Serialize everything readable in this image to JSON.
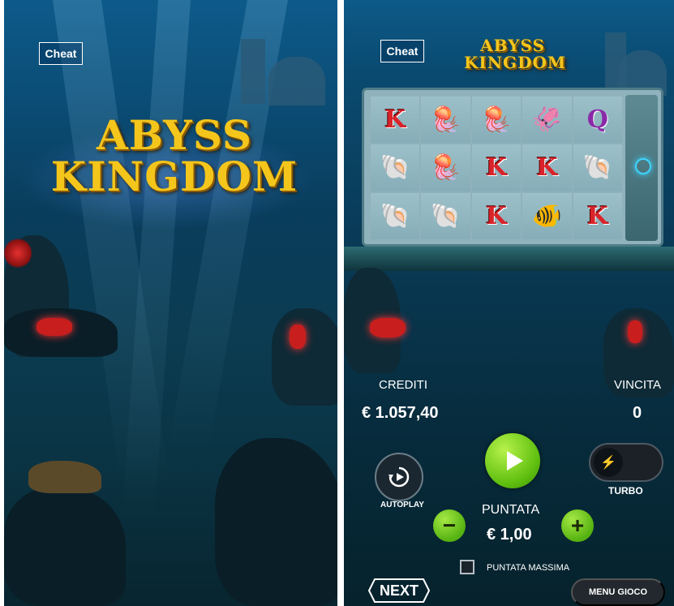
{
  "left": {
    "cheat_label": "Cheat",
    "logo_line1": "ABYSS",
    "logo_line2": "KINGDOM"
  },
  "right": {
    "cheat_label": "Cheat",
    "logo_line1": "ABYSS",
    "logo_line2": "KINGDOM",
    "reels": [
      [
        "K",
        "🪼",
        "🪼",
        "🦑",
        "Q"
      ],
      [
        "🐚",
        "🪼",
        "K",
        "K",
        "🐚"
      ],
      [
        "🐚",
        "🐚",
        "K",
        "🐠",
        "K"
      ]
    ],
    "hud": {
      "credits_label": "CREDITI",
      "credits_value": "€ 1.057,40",
      "win_label": "VINCITA",
      "win_value": "0",
      "bet_label": "PUNTATA",
      "bet_value": "€ 1,00",
      "autoplay_label": "AUTOPLAY",
      "turbo_label": "TURBO",
      "max_bet_label": "PUNTATA MASSIMA",
      "menu_label": "MENU GIOCO",
      "brand_label": "NEXT",
      "minus_label": "−",
      "plus_label": "+"
    }
  }
}
